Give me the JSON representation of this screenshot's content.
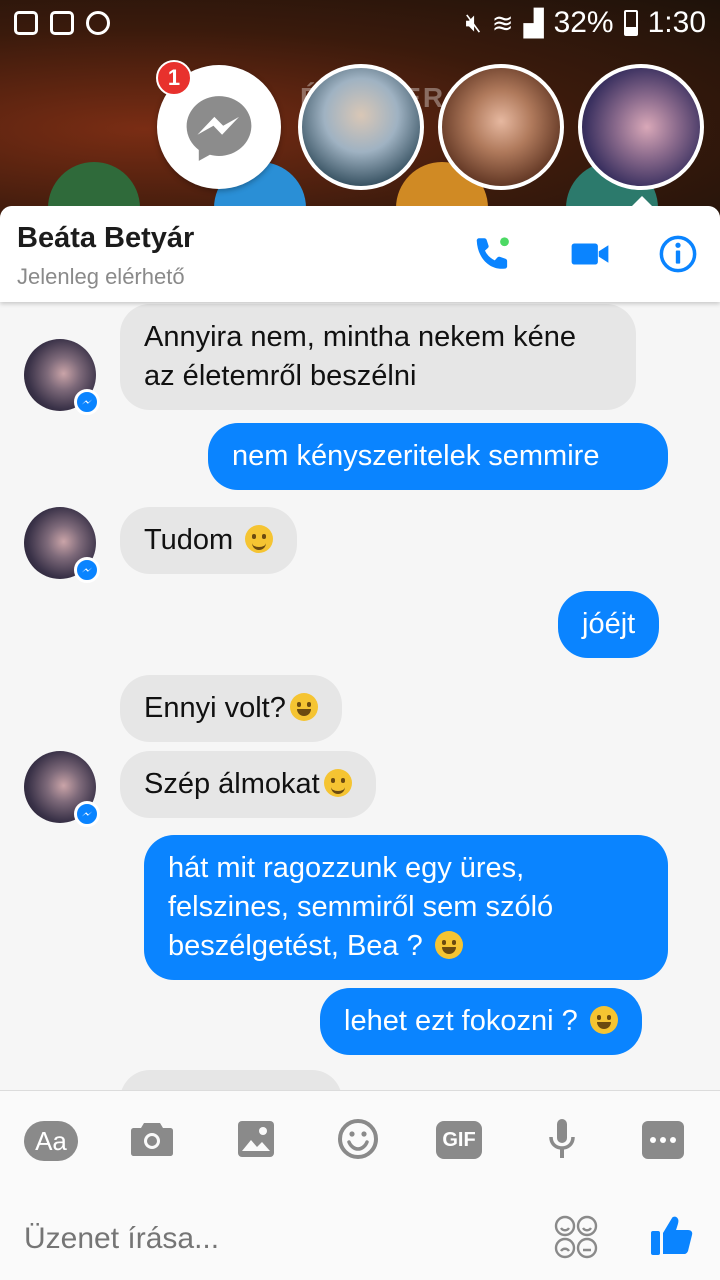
{
  "status_bar": {
    "battery": "32%",
    "time": "1:30"
  },
  "chat_heads": {
    "badge_count": "1",
    "wallpaper_text": "ÉSE-Z ER"
  },
  "header": {
    "name": "Beáta Betyár",
    "status": "Jelenleg elérhető"
  },
  "messages": [
    {
      "dir": "in",
      "text": "Annyira nem, mintha nekem kéne az életemről beszélni"
    },
    {
      "dir": "out",
      "text": "nem kényszeritelek semmire"
    },
    {
      "dir": "in",
      "text": "Tudom"
    },
    {
      "dir": "out",
      "text": "jóéjt"
    },
    {
      "dir": "in",
      "text": "Ennyi volt?"
    },
    {
      "dir": "in",
      "text": "Szép álmokat"
    },
    {
      "dir": "out",
      "text": "hát mit ragozzunk egy üres, felszines, semmiről sem szóló beszélgetést, Bea ?"
    },
    {
      "dir": "out",
      "text": "lehet ezt fokozni ?"
    }
  ],
  "composer": {
    "aa_label": "Aa",
    "gif_label": "GIF",
    "placeholder": "Üzenet írása..."
  },
  "colors": {
    "accent": "#0a84ff",
    "incoming_bubble": "#e6e6e6",
    "badge": "#e8312d"
  },
  "icons": [
    "call-icon",
    "video-icon",
    "info-icon",
    "camera-icon",
    "image-icon",
    "emoji-icon",
    "mic-icon",
    "more-icon",
    "sticker-icon",
    "like-icon"
  ]
}
